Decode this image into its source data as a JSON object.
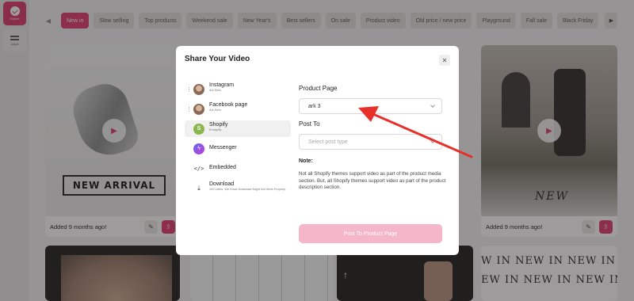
{
  "sidebar": {
    "items": [
      {
        "label": "Explore",
        "icon": "check-circle-icon",
        "active": true
      },
      {
        "label": "Adjust",
        "icon": "sliders-icon",
        "active": false
      }
    ]
  },
  "filters": {
    "chips": [
      "New in",
      "Slow selling",
      "Top products",
      "Weekend sale",
      "New Year's",
      "Best sellers",
      "On sale",
      "Product video",
      "Old price / new price",
      "Playground",
      "Fall sale",
      "Black Friday"
    ],
    "active_index": 0,
    "prev_icon": "chevron-left-icon",
    "next_icon": "chevron-right-icon"
  },
  "cards": {
    "left": {
      "added": "Added 9 months ago!",
      "badge": "NEW ARRIVAL"
    },
    "right": {
      "added": "Added 9 months ago!",
      "badge": "NEW"
    },
    "bottom_right_text": [
      "W IN NEW IN NEW IN N",
      "EW IN NEW IN NEW IN"
    ]
  },
  "modal": {
    "title": "Share Your Video",
    "close": "✕",
    "platforms": [
      {
        "name": "Instagram",
        "sub": "Ark Klein",
        "icon": "avatar-icon",
        "draggable": true
      },
      {
        "name": "Facebook page",
        "sub": "Ark Klein",
        "icon": "avatar-icon",
        "draggable": true
      },
      {
        "name": "Shopify",
        "sub": "Embiplify",
        "icon": "shopify-icon",
        "selected": true
      },
      {
        "name": "Messenger",
        "icon": "messenger-icon"
      },
      {
        "name": "Embedded",
        "icon": "code-icon"
      },
      {
        "name": "Download",
        "sub": "100 Users, We Know Download Might Not Work Properly.",
        "icon": "download-icon"
      }
    ],
    "product_page": {
      "label": "Product Page",
      "value": "ark 3"
    },
    "post_to": {
      "label": "Post To",
      "placeholder": "Select post type"
    },
    "note": {
      "heading": "Note:",
      "text": "Not all Shopify themes support video as part of the product media section. But, all Shopify themes support video as part of the product description section."
    },
    "submit_label": "Post To Product Page"
  },
  "colors": {
    "accent": "#e0356c",
    "button_disabled": "#f6b6c9",
    "annotation": "#e8302a"
  }
}
